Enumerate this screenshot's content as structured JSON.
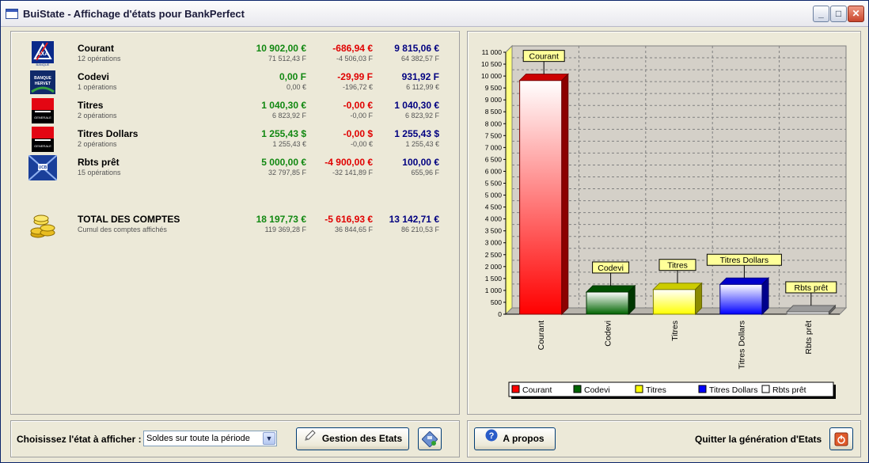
{
  "window": {
    "title": "BuiState  -  Affichage d'états pour BankPerfect"
  },
  "accounts": [
    {
      "name": "Courant",
      "ops": "12 opérations",
      "v1": "10 902,00 €",
      "v1s": "71 512,43 F",
      "v2": "-686,94 €",
      "v2s": "-4 506,03 F",
      "v3": "9 815,06 €",
      "v3s": "64 382,57 F",
      "logo": "axa-logo"
    },
    {
      "name": "Codevi",
      "ops": "1 opérations",
      "v1": "0,00 F",
      "v1s": "0,00 €",
      "v2": "-29,99 F",
      "v2s": "-196,72 €",
      "v3": "931,92 F",
      "v3s": "6 112,99 €",
      "logo": "banque-hervet-logo"
    },
    {
      "name": "Titres",
      "ops": "2 opérations",
      "v1": "1 040,30 €",
      "v1s": "6 823,92 F",
      "v2": "-0,00 €",
      "v2s": "-0,00 F",
      "v3": "1 040,30 €",
      "v3s": "6 823,92 F",
      "logo": "societe-generale-logo"
    },
    {
      "name": "Titres Dollars",
      "ops": "2 opérations",
      "v1": "1 255,43 $",
      "v1s": "1 255,43 €",
      "v2": "-0,00 $",
      "v2s": "-0,00 €",
      "v3": "1 255,43 $",
      "v3s": "1 255,43 €",
      "logo": "societe-generale-logo"
    },
    {
      "name": "Rbts prêt",
      "ops": "15 opérations",
      "v1": "5 000,00 €",
      "v1s": "32 797,85 F",
      "v2": "-4 900,00 €",
      "v2s": "-32 141,89 F",
      "v3": "100,00 €",
      "v3s": "655,96 F",
      "logo": "ucb-logo"
    }
  ],
  "total": {
    "name": "TOTAL DES COMPTES",
    "sub": "Cumul des comptes affichés",
    "v1": "18 197,73 €",
    "v1s": "119 369,28 F",
    "v2": "-5 616,93 €",
    "v2s": "36 844,65 F",
    "v3": "13 142,71 €",
    "v3s": "86 210,53 F"
  },
  "logo_text": {
    "axa": "AXA",
    "axa_sub": "BANQUE",
    "hervet": "BANQUE HERVET",
    "sg": "GENERALE",
    "ucb": "UCB"
  },
  "chart_data": {
    "type": "bar",
    "categories": [
      "Courant",
      "Codevi",
      "Titres",
      "Titres Dollars",
      "Rbts prêt"
    ],
    "values": [
      9815.06,
      931.92,
      1040.3,
      1255.43,
      100.0
    ],
    "colors": [
      "#ff0000",
      "#006400",
      "#ffff00",
      "#0000ff",
      "#c0c0c0"
    ],
    "ylim": [
      0,
      11000
    ],
    "yticks": [
      "0",
      "500",
      "1 000",
      "1 500",
      "2 000",
      "2 500",
      "3 000",
      "3 500",
      "4 000",
      "4 500",
      "5 000",
      "5 500",
      "6 000",
      "6 500",
      "7 000",
      "7 500",
      "8 000",
      "8 500",
      "9 000",
      "9 500",
      "10 000",
      "10 500",
      "11 000"
    ],
    "legend": [
      "Courant",
      "Codevi",
      "Titres",
      "Titres Dollars",
      "Rbts prêt"
    ],
    "grid": true,
    "legend_placement": "bottom"
  },
  "footer": {
    "choose_label": "Choisissez l'état à afficher :",
    "select_value": "Soldes sur toute la période",
    "manage_button": "Gestion des Etats",
    "about_button": "A propos",
    "quit_label": "Quitter la génération d'Etats"
  }
}
